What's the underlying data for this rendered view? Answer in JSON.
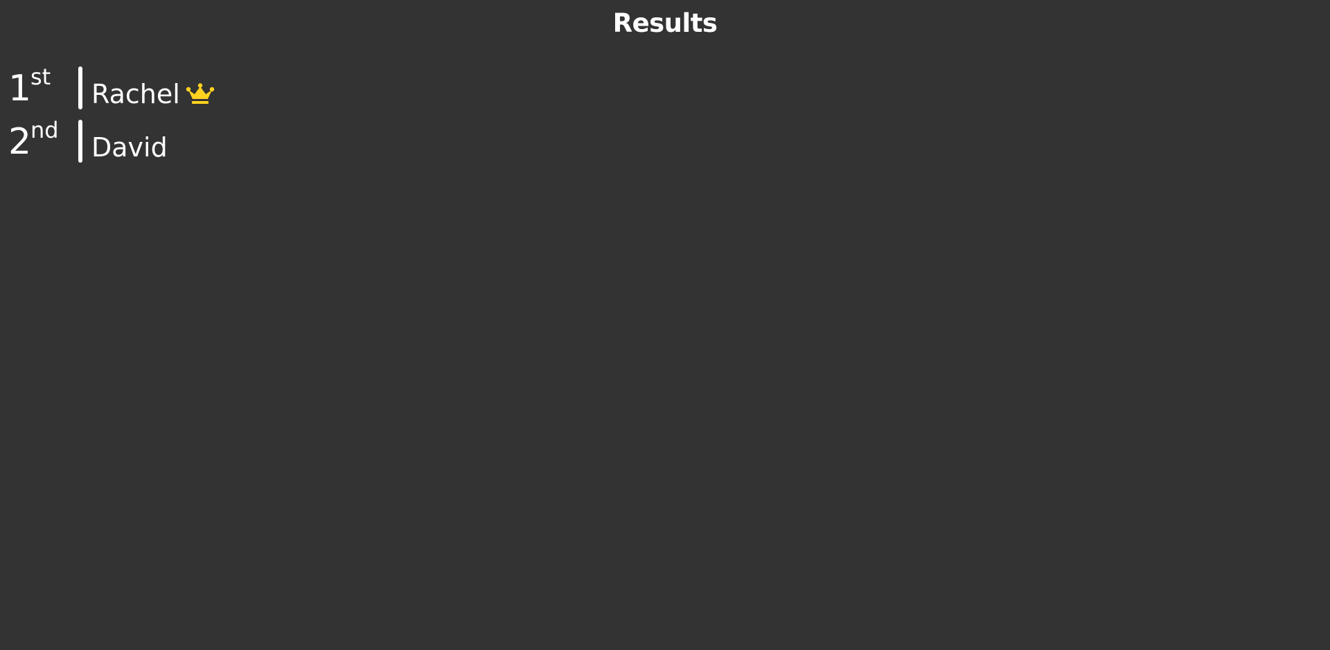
{
  "page": {
    "title": "Results"
  },
  "results": [
    {
      "rank_number": "1",
      "rank_suffix": "st",
      "name": "Rachel",
      "winner": true
    },
    {
      "rank_number": "2",
      "rank_suffix": "nd",
      "name": "David",
      "winner": false
    }
  ],
  "colors": {
    "background": "#333333",
    "text": "#ffffff",
    "crown": "#FFD21F"
  },
  "icons": {
    "winner": "crown-icon"
  }
}
